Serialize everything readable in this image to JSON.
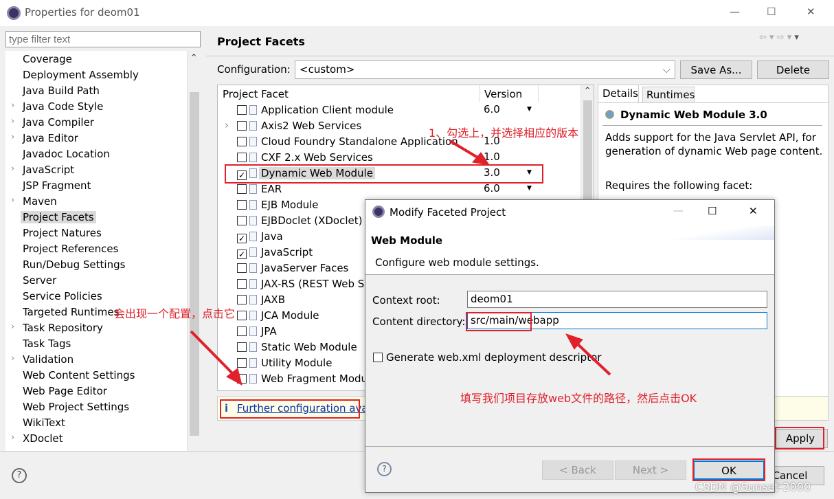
{
  "window": {
    "title": "Properties for deom01",
    "min": "—",
    "max": "☐",
    "close": "✕"
  },
  "filter": {
    "placeholder": "type filter text"
  },
  "sidebar": {
    "items": [
      {
        "label": "Coverage",
        "exp": false
      },
      {
        "label": "Deployment Assembly",
        "exp": false
      },
      {
        "label": "Java Build Path",
        "exp": false
      },
      {
        "label": "Java Code Style",
        "exp": true
      },
      {
        "label": "Java Compiler",
        "exp": true
      },
      {
        "label": "Java Editor",
        "exp": true
      },
      {
        "label": "Javadoc Location",
        "exp": false
      },
      {
        "label": "JavaScript",
        "exp": true
      },
      {
        "label": "JSP Fragment",
        "exp": false
      },
      {
        "label": "Maven",
        "exp": true
      },
      {
        "label": "Project Facets",
        "exp": false,
        "selected": true
      },
      {
        "label": "Project Natures",
        "exp": false
      },
      {
        "label": "Project References",
        "exp": false
      },
      {
        "label": "Run/Debug Settings",
        "exp": false
      },
      {
        "label": "Server",
        "exp": false
      },
      {
        "label": "Service Policies",
        "exp": false
      },
      {
        "label": "Targeted Runtimes",
        "exp": false
      },
      {
        "label": "Task Repository",
        "exp": true
      },
      {
        "label": "Task Tags",
        "exp": false
      },
      {
        "label": "Validation",
        "exp": true
      },
      {
        "label": "Web Content Settings",
        "exp": false
      },
      {
        "label": "Web Page Editor",
        "exp": false
      },
      {
        "label": "Web Project Settings",
        "exp": false
      },
      {
        "label": "WikiText",
        "exp": false
      },
      {
        "label": "XDoclet",
        "exp": true
      }
    ]
  },
  "page": {
    "title": "Project Facets",
    "config_label": "Configuration:",
    "config_value": "<custom>",
    "save_as": "Save As...",
    "delete": "Delete"
  },
  "facets": {
    "col_facet": "Project Facet",
    "col_version": "Version",
    "rows": [
      {
        "name": "Application Client module",
        "checked": false,
        "version": "6.0",
        "dd": true
      },
      {
        "name": "Axis2 Web Services",
        "checked": false,
        "version": "",
        "dd": false,
        "exp": true
      },
      {
        "name": "Cloud Foundry Standalone Application",
        "checked": false,
        "version": "1.0",
        "dd": false
      },
      {
        "name": "CXF 2.x Web Services",
        "checked": false,
        "version": "1.0",
        "dd": false
      },
      {
        "name": "Dynamic Web Module",
        "checked": true,
        "version": "3.0",
        "dd": true,
        "selected": true
      },
      {
        "name": "EAR",
        "checked": false,
        "version": "6.0",
        "dd": true
      },
      {
        "name": "EJB Module",
        "checked": false,
        "version": "",
        "dd": false
      },
      {
        "name": "EJBDoclet (XDoclet)",
        "checked": false,
        "version": "",
        "dd": false
      },
      {
        "name": "Java",
        "checked": true,
        "version": "",
        "dd": false
      },
      {
        "name": "JavaScript",
        "checked": true,
        "version": "",
        "dd": false
      },
      {
        "name": "JavaServer Faces",
        "checked": false,
        "version": "",
        "dd": false
      },
      {
        "name": "JAX-RS (REST Web Services)",
        "checked": false,
        "version": "",
        "dd": false
      },
      {
        "name": "JAXB",
        "checked": false,
        "version": "",
        "dd": false
      },
      {
        "name": "JCA Module",
        "checked": false,
        "version": "",
        "dd": false
      },
      {
        "name": "JPA",
        "checked": false,
        "version": "",
        "dd": false
      },
      {
        "name": "Static Web Module",
        "checked": false,
        "version": "",
        "dd": false
      },
      {
        "name": "Utility Module",
        "checked": false,
        "version": "",
        "dd": false
      },
      {
        "name": "Web Fragment Module",
        "checked": false,
        "version": "",
        "dd": false
      }
    ]
  },
  "details": {
    "tab_details": "Details",
    "tab_runtimes": "Runtimes",
    "title": "Dynamic Web Module 3.0",
    "desc": "Adds support for the Java Servlet API, for generation of dynamic Web page content.",
    "requires": "Requires the following facet:"
  },
  "info": {
    "link": "Further configuration available..."
  },
  "buttons": {
    "apply": "Apply",
    "cancel": "Cancel"
  },
  "dialog": {
    "title": "Modify Faceted Project",
    "heading": "Web Module",
    "subtitle": "Configure web module settings.",
    "context_label": "Context root:",
    "context_value": "deom01",
    "content_label": "Content directory:",
    "content_value": "src/main/webapp",
    "gen_label": "Generate web.xml deployment descriptor",
    "gen_checked": false,
    "back": "< Back",
    "next": "Next >",
    "ok": "OK"
  },
  "annotations": {
    "a1": "1、勾选上，并选择相应的版本",
    "a2": "会出现一个配置，点击它",
    "a3": "填写我们项目存放web文件的路径，然后点击OK",
    "color": "#e0212b"
  },
  "watermark": "CSDN @Sunset-2000"
}
